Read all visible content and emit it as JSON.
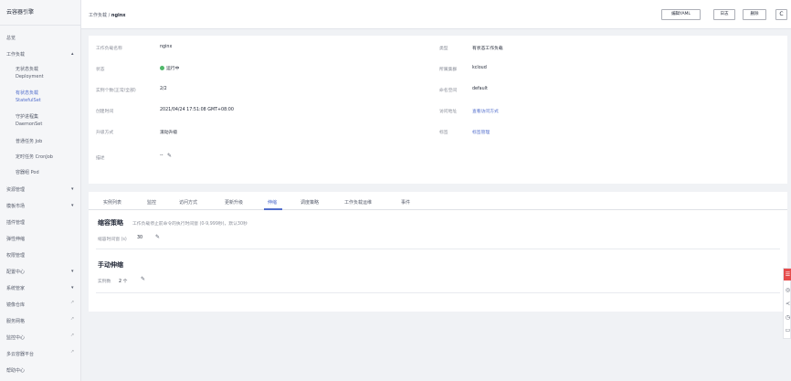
{
  "sidebar": {
    "title": "云容器引擎",
    "items": [
      {
        "label": "总览"
      },
      {
        "label": "工作负载",
        "arrow": "▴"
      },
      {
        "label": "无状态负载 Deployment"
      },
      {
        "label": "有状态负载 StatefulSet"
      },
      {
        "label": "守护进程集 DaemonSet"
      },
      {
        "label": "普通任务 Job"
      },
      {
        "label": "定时任务 CronJob"
      },
      {
        "label": "容器组 Pod"
      },
      {
        "label": "资源管理",
        "arrow": "▾"
      },
      {
        "label": "模板市场",
        "arrow": "▾"
      },
      {
        "label": "插件管理"
      },
      {
        "label": "弹性伸缩"
      },
      {
        "label": "权限管理"
      },
      {
        "label": "配置中心",
        "arrow": "▾"
      },
      {
        "label": "系统管家",
        "arrow": "▾"
      },
      {
        "label": "镜像仓库"
      },
      {
        "label": "服务网格"
      },
      {
        "label": "监控中心"
      },
      {
        "label": "多云容器平台"
      },
      {
        "label": "帮助中心"
      }
    ],
    "sub_lines": {
      "deployment": [
        "无状态负载",
        "Deployment"
      ],
      "statefulset": [
        "有状态负载",
        "StatefulSet"
      ],
      "daemonset": [
        "守护进程集",
        "DaemonSet"
      ]
    }
  },
  "header": {
    "breadcrumb_parent": "工作负载",
    "breadcrumb_sep": " / ",
    "breadcrumb_current": "nginx",
    "buttons": {
      "edit_yaml": "编辑YAML",
      "log": "日志",
      "delete": "删除",
      "refresh": "C"
    }
  },
  "details": {
    "left": [
      {
        "label": "工作负载名称",
        "value": "nginx"
      },
      {
        "label": "状态",
        "value": "运行中"
      },
      {
        "label": "实例个数(正常/全部)",
        "value": "2/2"
      },
      {
        "label": "创建时间",
        "value": "2021/04/24 17:51:08 GMT+08:00"
      },
      {
        "label": "升级方式",
        "value": "滚动升级"
      },
      {
        "label": "描述",
        "value": "--"
      }
    ],
    "right": [
      {
        "label": "类型",
        "value": "有状态工作负载"
      },
      {
        "label": "所属集群",
        "value": "kcloud"
      },
      {
        "label": "命名空间",
        "value": "default"
      },
      {
        "label": "访问地址",
        "value": "查看访问方式"
      },
      {
        "label": "标签",
        "value": "标签管理"
      }
    ]
  },
  "tabs": [
    "实例列表",
    "监控",
    "访问方式",
    "更新升级",
    "伸缩",
    "调度策略",
    "工作负载运维",
    "事件"
  ],
  "scaling": {
    "section_title": "缩容策略",
    "section_desc": "工作负载停止前命令的执行时间窗 (0-9,999秒)，默认30秒",
    "window_label": "缩容时间窗 (s)",
    "window_value": "30",
    "manual_title": "手动伸缩",
    "instances_label": "实例数",
    "instances_value": "2 个"
  },
  "colors": {
    "accent": "#526ecc",
    "running": "#50b86a",
    "danger": "#e64c4c"
  }
}
